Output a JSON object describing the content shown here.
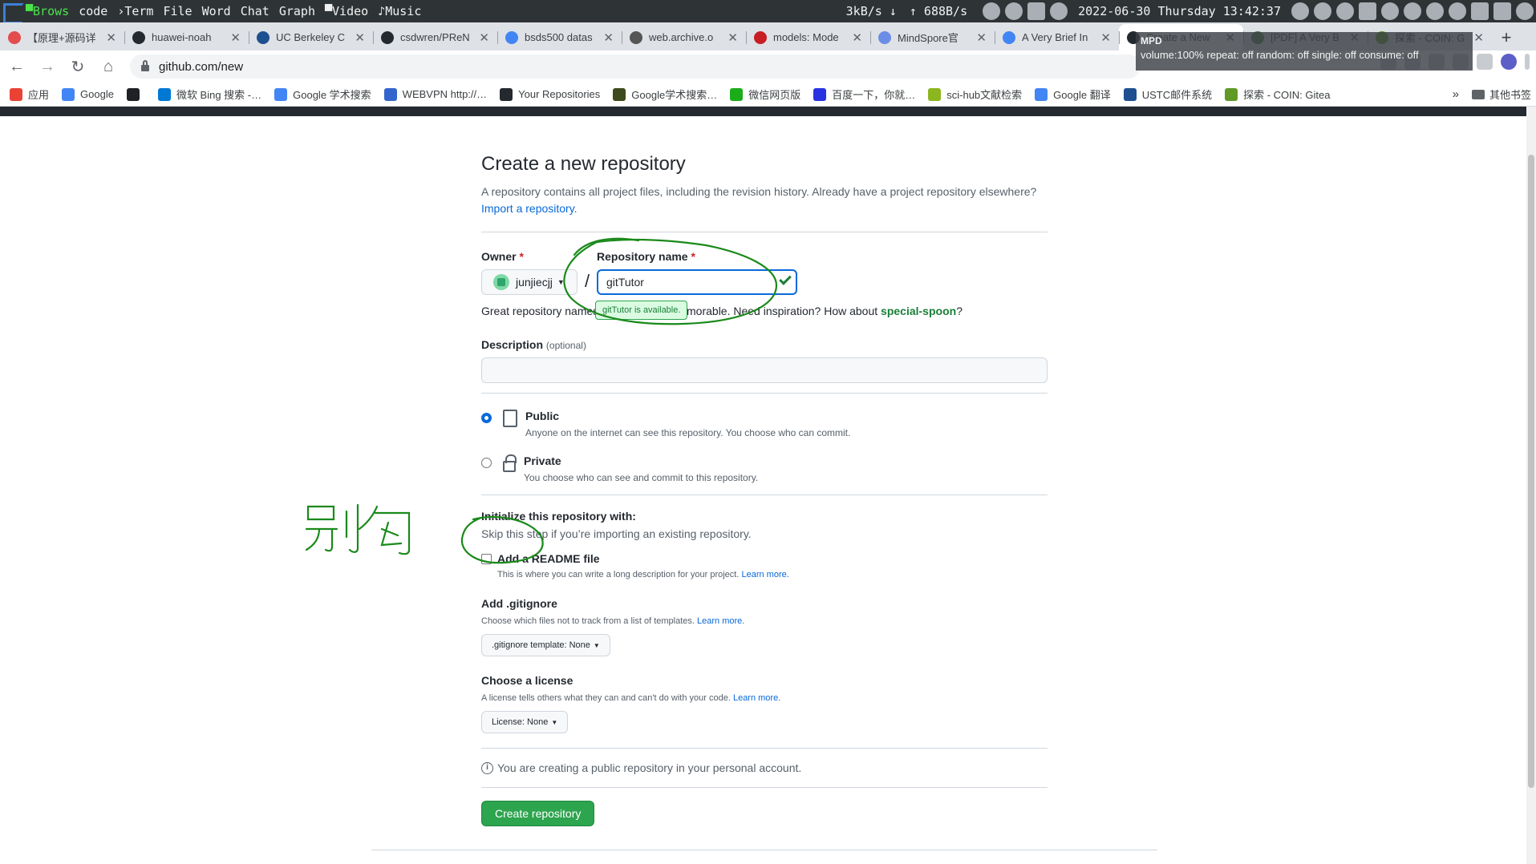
{
  "sysbar": {
    "workspaces": [
      "Brows",
      "code",
      "Term",
      "File",
      "Word",
      "Chat",
      "Graph",
      "Video",
      "Music"
    ],
    "workspace_glyphs": [
      "▀",
      "",
      "›",
      "",
      "",
      "",
      "",
      "▀",
      "♪"
    ],
    "net_down": "3kB/s ↓",
    "net_up": "↑ 688B/s",
    "datetime": "2022-06-30 Thursday 13:42:37"
  },
  "tabs": [
    {
      "title": "【原理+源码详",
      "color": "#e34c4c"
    },
    {
      "title": "huawei-noah",
      "color": "#24292f"
    },
    {
      "title": "UC Berkeley C",
      "color": "#1d4f91"
    },
    {
      "title": "csdwren/PReN",
      "color": "#24292f"
    },
    {
      "title": "bsds500 datas",
      "color": "#4285f4"
    },
    {
      "title": "web.archive.o",
      "color": "#555555"
    },
    {
      "title": "models: Mode",
      "color": "#c71d23"
    },
    {
      "title": "MindSpore官",
      "color": "#6b8de8"
    },
    {
      "title": "A Very Brief In",
      "color": "#4285f4"
    },
    {
      "title": "Create a New",
      "color": "#24292f"
    },
    {
      "title": "[PDF] A Very B",
      "color": "#4a7f4a"
    },
    {
      "title": "探索 - COIN: G",
      "color": "#609926"
    }
  ],
  "active_tab": 9,
  "url": "github.com/new",
  "mpd": {
    "title": "MPD",
    "status": "volume:100%  repeat: off  random: off  single: off  consume: off"
  },
  "bookmarks": [
    {
      "label": "应用",
      "color": "#ea4335"
    },
    {
      "label": "Google",
      "color": "#4285f4"
    },
    {
      "label": "",
      "color": "#202124"
    },
    {
      "label": "微软 Bing 搜索 -…",
      "color": "#0078d4"
    },
    {
      "label": "Google 学术搜索",
      "color": "#4285f4"
    },
    {
      "label": "WEBVPN http://…",
      "color": "#3366cc"
    },
    {
      "label": "Your Repositories",
      "color": "#24292f"
    },
    {
      "label": "Google学术搜索…",
      "color": "#3c4a1c"
    },
    {
      "label": "微信网页版",
      "color": "#1aad19"
    },
    {
      "label": "百度一下，你就…",
      "color": "#2932e1"
    },
    {
      "label": "sci-hub文献检索",
      "color": "#8bb61e"
    },
    {
      "label": "Google 翻译",
      "color": "#4285f4"
    },
    {
      "label": "USTC邮件系统",
      "color": "#1d4f91"
    },
    {
      "label": "探索 - COIN: Gitea",
      "color": "#609926"
    }
  ],
  "bookmarks_more": "»",
  "bookmarks_folder": "其他书签",
  "form": {
    "title": "Create a new repository",
    "subtitle": "A repository contains all project files, including the revision history. Already have a project repository elsewhere?",
    "import_link": "Import a repository.",
    "owner_label": "Owner",
    "required_mark": "*",
    "owner_value": "junjiecjj",
    "slash": "/",
    "repo_label": "Repository name",
    "repo_value": "gitTutor",
    "tooltip": "gitTutor is available.",
    "hint_prefix": "Great repository names are short and memorable. Need inspiration? How about",
    "hint_suggestion": "special-spoon",
    "hint_suffix": "?",
    "desc_label": "Description",
    "desc_optional": "(optional)",
    "public_label": "Public",
    "public_desc": "Anyone on the internet can see this repository. You choose who can commit.",
    "private_label": "Private",
    "private_desc": "You choose who can see and commit to this repository.",
    "init_title": "Initialize this repository with:",
    "init_sub": "Skip this step if you’re importing an existing repository.",
    "readme_label": "Add a README file",
    "readme_desc": "This is where you can write a long description for your project.",
    "learn_more": "Learn more.",
    "gitignore_title": "Add .gitignore",
    "gitignore_desc": "Choose which files not to track from a list of templates.",
    "gitignore_select": ".gitignore template: None",
    "license_title": "Choose a license",
    "license_desc": "A license tells others what they can and can't do with your code.",
    "license_select": "License: None",
    "notice": "You are creating a public repository in your personal account.",
    "create_button": "Create repository"
  },
  "annotation": {
    "handwritten_note": "别勾",
    "color": "#1a8a1a"
  }
}
